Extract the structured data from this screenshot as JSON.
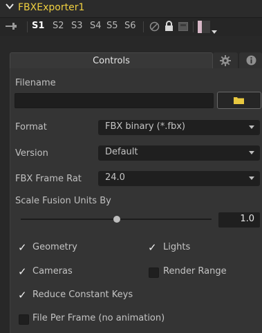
{
  "node": {
    "title": "FBXExporter1",
    "collapse_icon": "chevron-down-icon"
  },
  "slots": [
    "S1",
    "S2",
    "S3",
    "S4",
    "S5",
    "S6"
  ],
  "tabs": {
    "controls": "Controls",
    "settings_icon": "gear-icon",
    "info_icon": "info-icon"
  },
  "filename": {
    "label": "Filename",
    "value": "",
    "browse_icon": "folder-icon"
  },
  "format": {
    "label": "Format",
    "value": "FBX binary (*.fbx)"
  },
  "version": {
    "label": "Version",
    "value": "Default"
  },
  "frame_rate": {
    "label": "FBX Frame Rat",
    "value": "24.0"
  },
  "scale": {
    "label": "Scale Fusion Units By",
    "value": "1.0"
  },
  "checkboxes": {
    "geometry": {
      "label": "Geometry",
      "checked": true
    },
    "lights": {
      "label": "Lights",
      "checked": true
    },
    "cameras": {
      "label": "Cameras",
      "checked": true
    },
    "render_range": {
      "label": "Render Range",
      "checked": false
    },
    "reduce_keys": {
      "label": "Reduce Constant Keys",
      "checked": true
    },
    "file_per_frame": {
      "label": "File Per Frame (no animation)",
      "checked": false
    }
  },
  "colors": {
    "title": "#f0d040",
    "accent_swatch": "#d8b8c8"
  }
}
